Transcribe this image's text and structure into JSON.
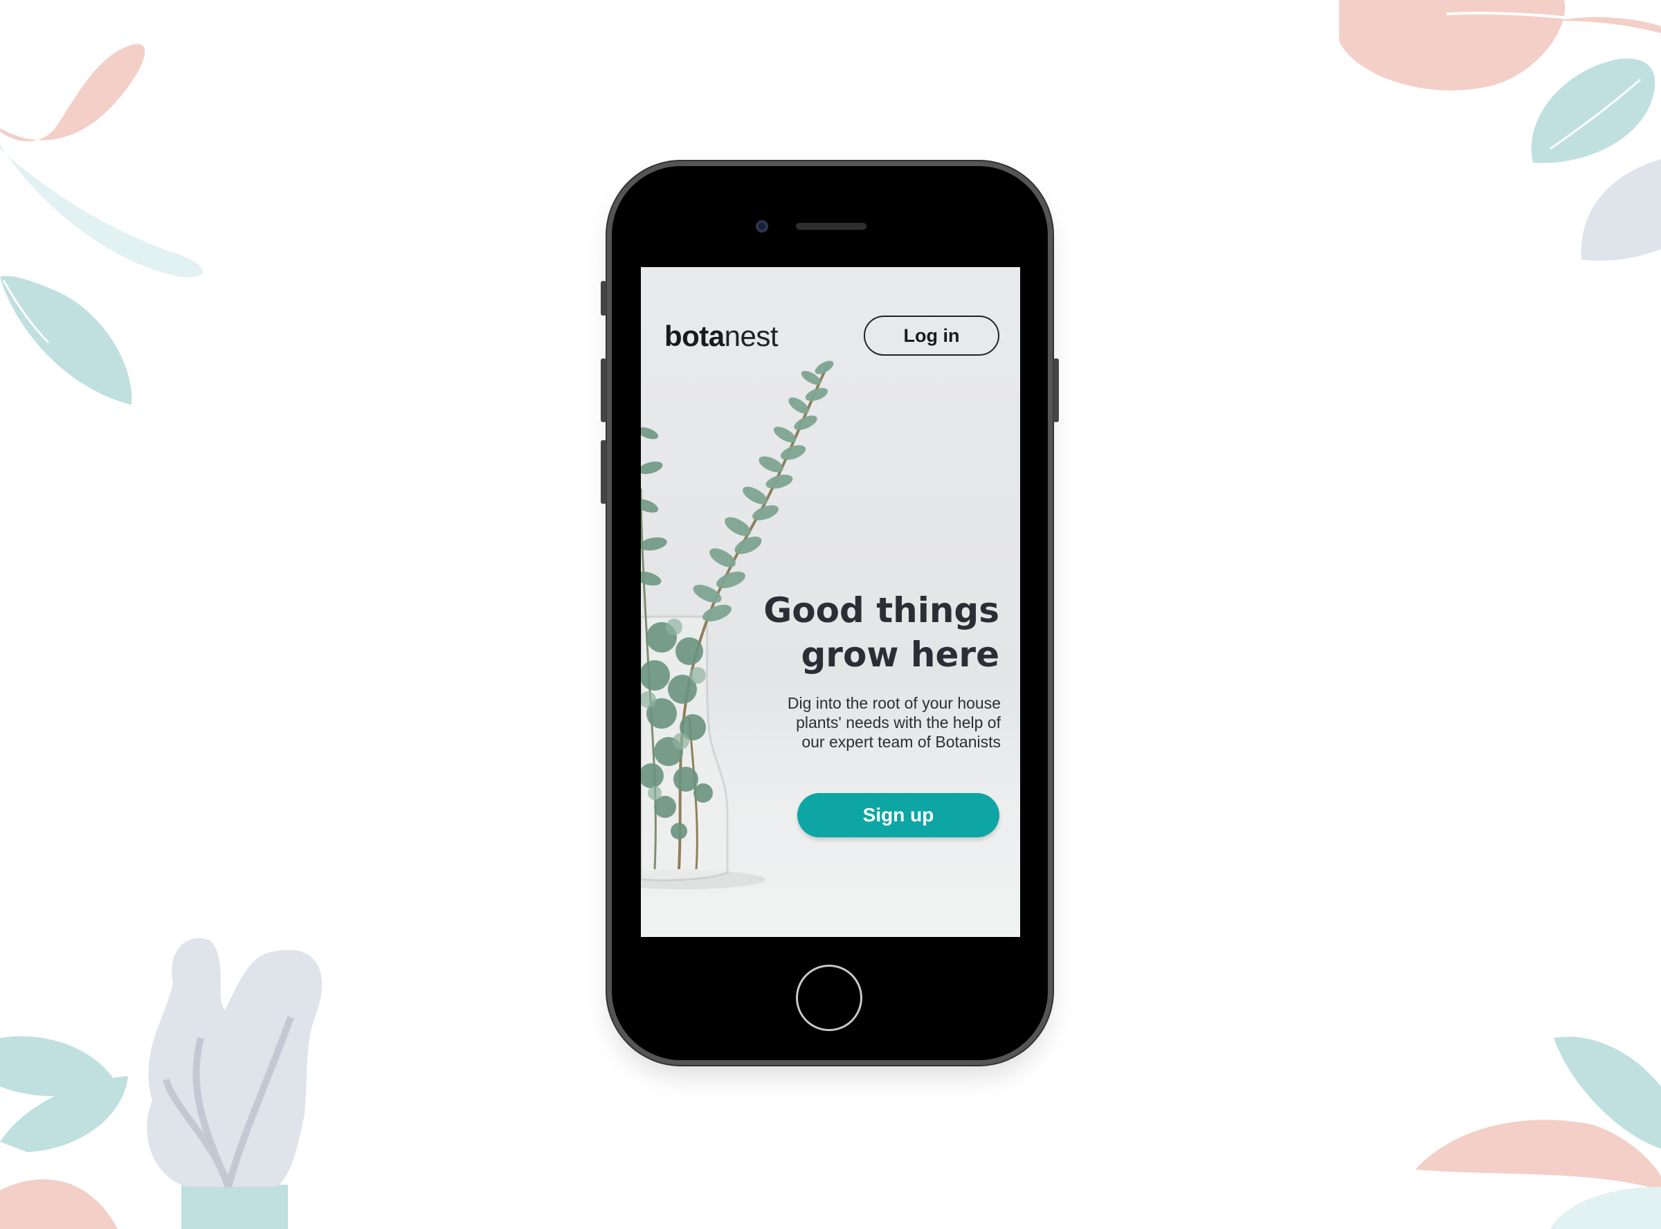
{
  "app": {
    "logo_bold": "bota",
    "logo_light": "nest"
  },
  "header": {
    "login_label": "Log in"
  },
  "hero": {
    "headline_line1": "Good things",
    "headline_line2": "grow here",
    "sub_line1": "Dig into the root of your house",
    "sub_line2": "plants' needs with the help of",
    "sub_line3": "our expert team of Botanists",
    "signup_label": "Sign up"
  },
  "colors": {
    "accent": "#0ea5a5",
    "leaf_pink": "#f3cfc7",
    "leaf_teal": "#bfe0df",
    "leaf_grey": "#dfe3ea"
  }
}
